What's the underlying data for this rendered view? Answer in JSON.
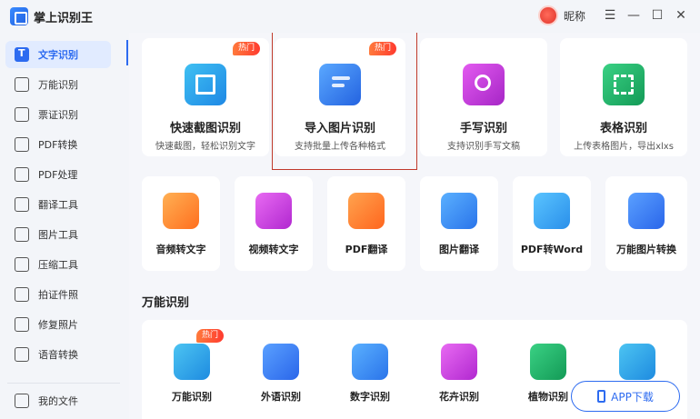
{
  "app": {
    "title": "掌上识别王"
  },
  "user": {
    "nickname": "昵称"
  },
  "window_controls": {
    "menu": "☰",
    "minimize": "—",
    "maximize": "☐",
    "close": "✕"
  },
  "sidebar": {
    "items": [
      {
        "label": "文字识别",
        "active": true
      },
      {
        "label": "万能识别"
      },
      {
        "label": "票证识别"
      },
      {
        "label": "PDF转换"
      },
      {
        "label": "PDF处理"
      },
      {
        "label": "翻译工具"
      },
      {
        "label": "图片工具"
      },
      {
        "label": "压缩工具"
      },
      {
        "label": "拍证件照"
      },
      {
        "label": "修复照片"
      },
      {
        "label": "语音转换"
      }
    ],
    "footer": {
      "label": "我的文件"
    }
  },
  "big_cards": [
    {
      "title": "快速截图识别",
      "desc": "快速截图，轻松识别文字",
      "badge": "热门",
      "color": "#29a3e8"
    },
    {
      "title": "导入图片识别",
      "desc": "支持批量上传各种格式",
      "badge": "热门",
      "color": "#2f7df0",
      "selected": true
    },
    {
      "title": "手写识别",
      "desc": "支持识别手写文稿",
      "color": "#c63ad9"
    },
    {
      "title": "表格识别",
      "desc": "上传表格图片，导出xlxs",
      "color": "#22b069"
    }
  ],
  "tool_cards": [
    {
      "title": "音频转文字",
      "color": "#ff8a2a"
    },
    {
      "title": "视频转文字",
      "color": "#d23ee0"
    },
    {
      "title": "PDF翻译",
      "color": "#ff7a2a"
    },
    {
      "title": "图片翻译",
      "color": "#2f88f5"
    },
    {
      "title": "PDF转Word",
      "color": "#2fa5f0"
    },
    {
      "title": "万能图片转换",
      "color": "#2f7df0"
    }
  ],
  "section": {
    "title": "万能识别"
  },
  "universal_cards": [
    {
      "title": "万能识别",
      "badge": "热门",
      "color": "#29a8e8"
    },
    {
      "title": "外语识别",
      "color": "#2f7df0"
    },
    {
      "title": "数字识别",
      "color": "#2f88f5"
    },
    {
      "title": "花卉识别",
      "color": "#d23ee0"
    },
    {
      "title": "植物识别",
      "color": "#22b069"
    },
    {
      "title": "",
      "color": "#29a8e8"
    }
  ],
  "app_download": {
    "label": "APP下载"
  }
}
